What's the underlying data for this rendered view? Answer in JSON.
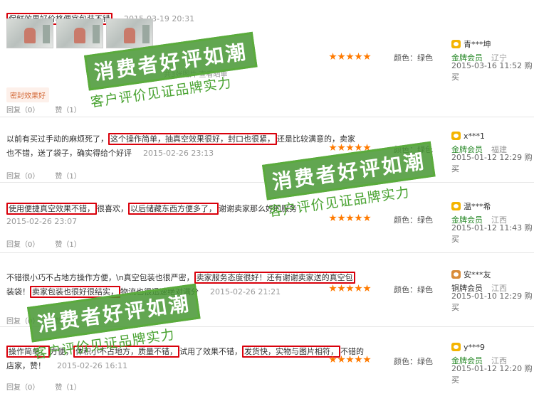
{
  "reviews": [
    {
      "lines": [
        [
          {
            "t": "保鲜效果好价格便宜包装不错",
            "hl": true
          }
        ]
      ],
      "date": "2015-03-19 20:31",
      "thumb_caption": "共3张图片 查看晒单",
      "tag": "密封效果好",
      "color": "颜色：绿色",
      "user": "青***坤",
      "level": "金牌会员",
      "location": "辽宁",
      "user_date": "2015-03-16 11:52 购买",
      "reply": "回复（0）",
      "like": "赞（1）"
    },
    {
      "lines": [
        [
          {
            "t": "以前有买过手动的麻烦死了，"
          },
          {
            "t": "这个操作简单，抽真空效果很好，封口也很紧，",
            "hl": true
          },
          {
            "t": "还是比较满意的，卖家"
          }
        ],
        [
          {
            "t": "也不错，送了袋子，确实得给个好评"
          }
        ]
      ],
      "date": "2015-02-26 23:13",
      "color": "颜色：绿色",
      "user": "x***1",
      "level": "金牌会员",
      "location": "福建",
      "user_date": "2015-01-12 12:29 购买",
      "reply": "回复（0）",
      "like": "赞（1）"
    },
    {
      "lines": [
        [
          {
            "t": "使用便捷真空效果不错，",
            "hl": true
          },
          {
            "t": "很喜欢，"
          },
          {
            "t": "以后储藏东西方便多了，",
            "hl": true
          },
          {
            "t": "谢谢卖家那么好的服务"
          }
        ]
      ],
      "date": "2015-02-26 23:07",
      "color": "颜色：绿色",
      "user": "温***希",
      "level": "金牌会员",
      "location": "江西",
      "user_date": "2015-01-12 11:43 购买",
      "reply": "回复（0）",
      "like": "赞（1）"
    },
    {
      "lines": [
        [
          {
            "t": "不错很小巧不占地方操作方便，\\n真空包装也很严密，"
          },
          {
            "t": "卖家服务态度很好！还有谢谢卖家送的真空包",
            "hl": true
          }
        ],
        [
          {
            "t": "装袋！"
          },
          {
            "t": "卖家包装也很好很结实，",
            "hl": true
          },
          {
            "t": "物流也很迅速绝对满分"
          }
        ]
      ],
      "date": "2015-02-26 21:21",
      "color": "颜色：绿色",
      "user": "安***友",
      "level": "铜牌会员",
      "location": "江西",
      "user_date": "2015-01-10 12:29 购买",
      "reply": "回复（0）",
      "like": "赞（1）"
    },
    {
      "lines": [
        [
          {
            "t": "操作简单，",
            "hl": true
          },
          {
            "t": "方便，"
          },
          {
            "t": "体积小不占地方，质量不错，",
            "hl": true
          },
          {
            "t": "试用了效果不错，"
          },
          {
            "t": "发货快，实物与图片相符，",
            "hl": true
          },
          {
            "t": "不错的"
          }
        ],
        [
          {
            "t": "店家，赞！"
          }
        ]
      ],
      "date": "2015-02-26 16:11",
      "color": "颜色：绿色",
      "user": "y***9",
      "level": "金牌会员",
      "location": "江西",
      "user_date": "2015-01-12 12:20 购买",
      "reply": "回复（0）",
      "like": "赞（1）"
    }
  ],
  "watermark": {
    "title": "消费者好评如潮",
    "subtitle": "客户评价见证品牌实力"
  },
  "accent": "#d9000b",
  "star_color": "#ff7a00"
}
